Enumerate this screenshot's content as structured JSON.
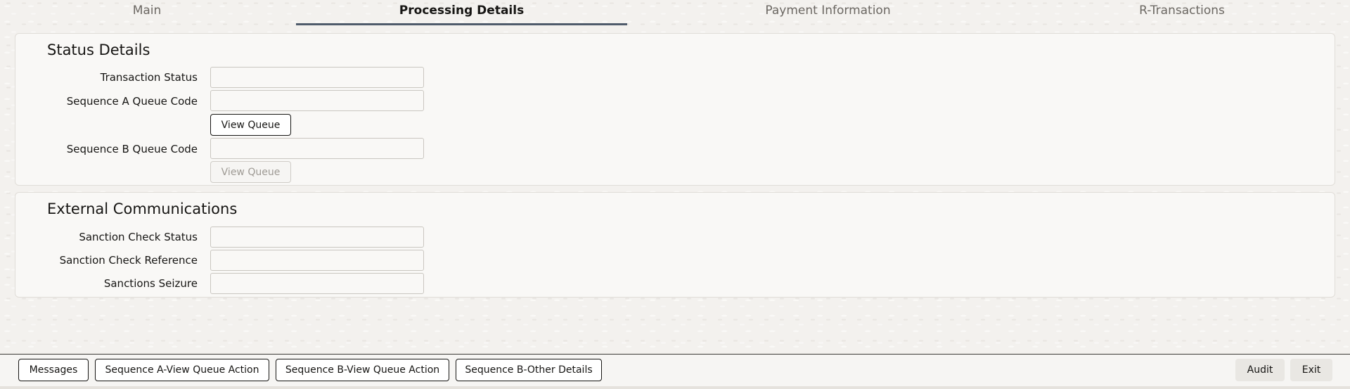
{
  "tabs": [
    {
      "label": "Main"
    },
    {
      "label": "Processing Details"
    },
    {
      "label": "Payment Information"
    },
    {
      "label": "R-Transactions"
    }
  ],
  "status_details": {
    "title": "Status Details",
    "transaction_status": {
      "label": "Transaction Status",
      "value": ""
    },
    "sequence_a_queue_code": {
      "label": "Sequence A Queue Code",
      "value": ""
    },
    "view_queue_a": "View Queue",
    "sequence_b_queue_code": {
      "label": "Sequence B Queue Code",
      "value": ""
    },
    "view_queue_b": "View Queue"
  },
  "external_communications": {
    "title": "External Communications",
    "sanction_check_status": {
      "label": "Sanction Check Status",
      "value": ""
    },
    "sanction_check_reference": {
      "label": "Sanction Check Reference",
      "value": ""
    },
    "sanctions_seizure": {
      "label": "Sanctions Seizure",
      "value": ""
    }
  },
  "footer": {
    "messages": "Messages",
    "seq_a_view_queue_action": "Sequence A-View Queue Action",
    "seq_b_view_queue_action": "Sequence B-View Queue Action",
    "seq_b_other_details": "Sequence B-Other Details",
    "audit": "Audit",
    "exit": "Exit"
  },
  "colors": {
    "active_tab_underline": "#4f5b6b",
    "text": "#161513",
    "muted_text": "#6b6762"
  }
}
